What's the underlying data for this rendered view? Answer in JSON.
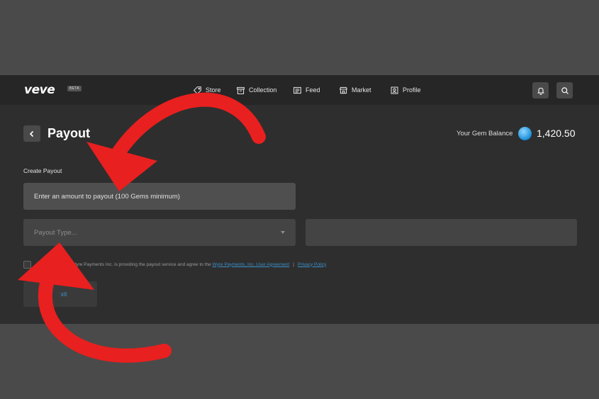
{
  "nav": {
    "logo": "veve",
    "beta_badge": "BETA",
    "items": [
      {
        "label": "Store",
        "icon": "tag-icon"
      },
      {
        "label": "Collection",
        "icon": "archive-icon"
      },
      {
        "label": "Feed",
        "icon": "news-icon"
      },
      {
        "label": "Market",
        "icon": "storefront-icon"
      },
      {
        "label": "Profile",
        "icon": "profile-icon"
      }
    ],
    "actions": [
      "bell-icon",
      "search-icon"
    ]
  },
  "page": {
    "title": "Payout",
    "gem_balance_label": "Your Gem Balance",
    "gem_balance_value": "1,420.50"
  },
  "form": {
    "section_label": "Create Payout",
    "amount_placeholder": "Enter an amount to payout (100 Gems minimum)",
    "payout_type_placeholder": "Payout Type...",
    "agreement_text": "at Wyre Payments Inc. is providing the payout service and agree to the",
    "agreement_link": "Wyre Payments, Inc. User Agreement",
    "separator": "|",
    "privacy_link": "Privacy Policy",
    "submit_label": "xit"
  },
  "colors": {
    "app_bg": "#2e2e2e",
    "nav_bg": "#262626",
    "field_bg": "#4f4f4f",
    "link": "#3b8fc9",
    "annotation_arrow": "#e8201f"
  }
}
